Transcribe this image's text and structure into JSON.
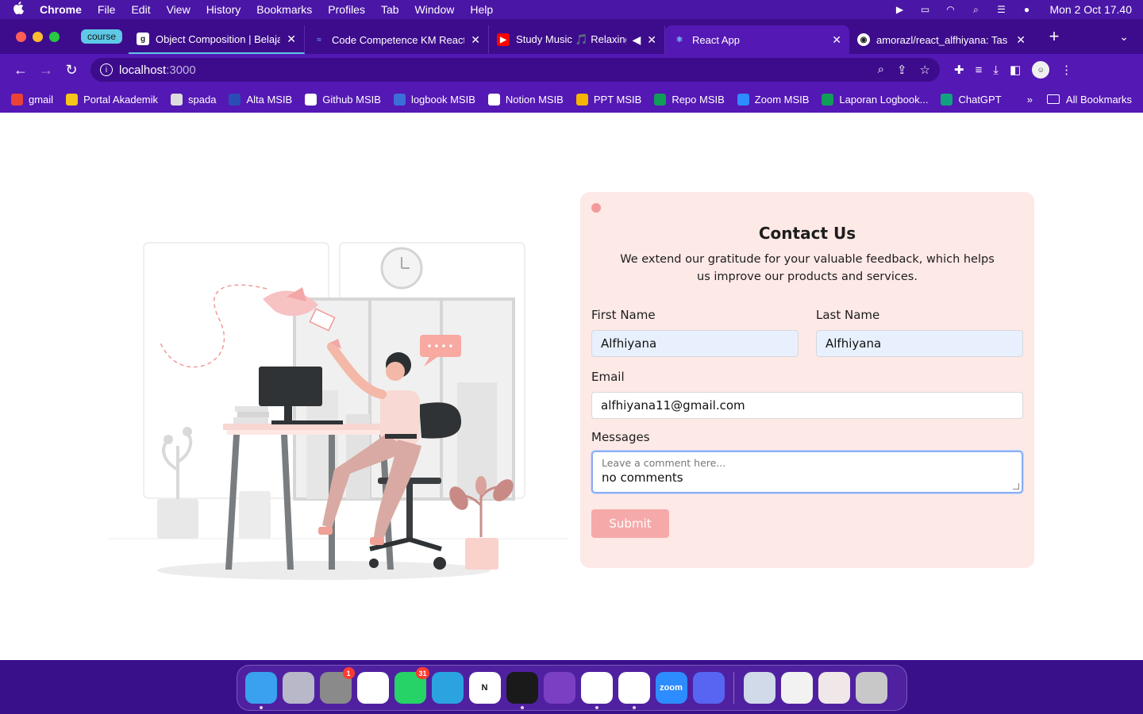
{
  "menubar": {
    "app_name": "Chrome",
    "menus": [
      "File",
      "Edit",
      "View",
      "History",
      "Bookmarks",
      "Profiles",
      "Tab",
      "Window",
      "Help"
    ],
    "clock": "Mon 2 Oct  17.40"
  },
  "tabs": {
    "group_label": "course",
    "items": [
      {
        "title": "Object Composition | Belajar",
        "icon": "g-icon"
      },
      {
        "title": "Code Competence KM React",
        "icon": "alterra-icon"
      },
      {
        "title": "Study Music 🎵 Relaxing",
        "icon": "youtube-icon"
      },
      {
        "title": "React App",
        "icon": "react-icon"
      },
      {
        "title": "amorazl/react_alfhiyana: Tas",
        "icon": "github-icon"
      }
    ]
  },
  "address": {
    "host": "localhost",
    "port": ":3000"
  },
  "bookmarks": [
    {
      "label": "gmail",
      "icon": "gmail-icon",
      "color": "#ea4335"
    },
    {
      "label": "Portal Akademik",
      "icon": "portal-icon",
      "color": "#f5c518"
    },
    {
      "label": "spada",
      "icon": "spada-icon",
      "color": "#dddddd"
    },
    {
      "label": "Alta MSIB",
      "icon": "alta-icon",
      "color": "#2a4db5"
    },
    {
      "label": "Github MSIB",
      "icon": "github-icon",
      "color": "#ffffff"
    },
    {
      "label": "logbook MSIB",
      "icon": "logbook-icon",
      "color": "#3a6fd8"
    },
    {
      "label": "Notion MSIB",
      "icon": "notion-icon",
      "color": "#ffffff"
    },
    {
      "label": "PPT MSIB",
      "icon": "slides-icon",
      "color": "#f5b400"
    },
    {
      "label": "Repo MSIB",
      "icon": "sheets-icon",
      "color": "#0f9d58"
    },
    {
      "label": "Zoom MSIB",
      "icon": "zoom-icon",
      "color": "#2d8cff"
    },
    {
      "label": "Laporan Logbook...",
      "icon": "sheets-icon",
      "color": "#0f9d58"
    },
    {
      "label": "ChatGPT",
      "icon": "chatgpt-icon",
      "color": "#10a37f"
    }
  ],
  "bookmarks_more": "»",
  "all_bookmarks": "All Bookmarks",
  "form": {
    "title": "Contact Us",
    "subtitle": "We extend our gratitude for your valuable feedback, which helps us improve our products and services.",
    "first_name_label": "First Name",
    "first_name_value": "Alfhiyana",
    "last_name_label": "Last Name",
    "last_name_value": "Alfhiyana",
    "email_label": "Email",
    "email_value": "alfhiyana11@gmail.com",
    "messages_label": "Messages",
    "messages_placeholder": "Leave a comment here...",
    "messages_value": "no comments",
    "submit_label": "Submit",
    "accent_color": "#f6a9a9"
  },
  "dock": {
    "apps": [
      {
        "name": "finder-icon",
        "color": "#3aa0f0",
        "label": "",
        "running": true
      },
      {
        "name": "launchpad-icon",
        "color": "#b8b8c8",
        "label": "",
        "running": false
      },
      {
        "name": "system-settings-icon",
        "color": "#8a8a8a",
        "label": "",
        "running": false,
        "badge": "1"
      },
      {
        "name": "slack-icon",
        "color": "#ffffff",
        "label": "",
        "running": false
      },
      {
        "name": "whatsapp-icon",
        "color": "#25d366",
        "label": "",
        "running": false,
        "badge": "31"
      },
      {
        "name": "telegram-icon",
        "color": "#2aa3e0",
        "label": "",
        "running": false
      },
      {
        "name": "notion-icon",
        "color": "#ffffff",
        "label": "N",
        "running": false
      },
      {
        "name": "terminal-icon",
        "color": "#1a1a1a",
        "label": "",
        "running": true
      },
      {
        "name": "github-desktop-icon",
        "color": "#7b3fc4",
        "label": "",
        "running": false
      },
      {
        "name": "vscode-icon",
        "color": "#ffffff",
        "label": "",
        "running": true
      },
      {
        "name": "chrome-icon",
        "color": "#ffffff",
        "label": "",
        "running": true
      },
      {
        "name": "zoom-icon",
        "color": "#2d8cff",
        "label": "zoom",
        "running": false
      },
      {
        "name": "discord-icon",
        "color": "#5865f2",
        "label": "",
        "running": false
      }
    ],
    "right_apps": [
      {
        "name": "preview-icon",
        "color": "#d0dae8"
      },
      {
        "name": "textedit-icon",
        "color": "#f2f2f2"
      },
      {
        "name": "downloads-stack-icon",
        "color": "#f0e8e8"
      },
      {
        "name": "trash-icon",
        "color": "#c8c8c8"
      }
    ]
  }
}
